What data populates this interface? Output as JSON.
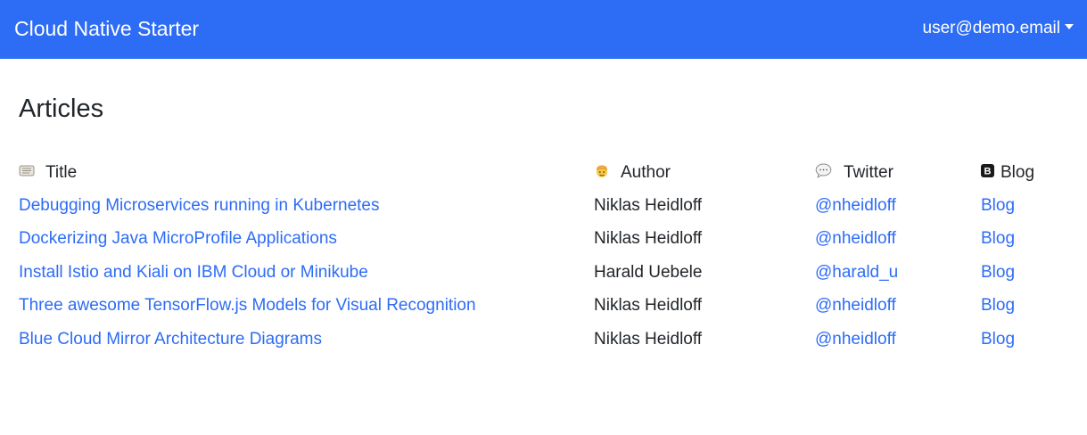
{
  "navbar": {
    "brand": "Cloud Native Starter",
    "user": "user@demo.email",
    "background": "#2d6cf5"
  },
  "page": {
    "title": "Articles"
  },
  "table": {
    "headers": {
      "title": "Title",
      "author": "Author",
      "twitter": "Twitter",
      "blog": "Blog"
    },
    "header_icons": {
      "title": "scroll-icon",
      "author": "person-icon",
      "twitter": "speech-balloon-icon",
      "blog": "bold-b-icon"
    },
    "rows": [
      {
        "title": "Debugging Microservices running in Kubernetes",
        "author": "Niklas Heidloff",
        "twitter": "@nheidloff",
        "blog": "Blog"
      },
      {
        "title": "Dockerizing Java MicroProfile Applications",
        "author": "Niklas Heidloff",
        "twitter": "@nheidloff",
        "blog": "Blog"
      },
      {
        "title": "Install Istio and Kiali on IBM Cloud or Minikube",
        "author": "Harald Uebele",
        "twitter": "@harald_u",
        "blog": "Blog"
      },
      {
        "title": "Three awesome TensorFlow.js Models for Visual Recognition",
        "author": "Niklas Heidloff",
        "twitter": "@nheidloff",
        "blog": "Blog"
      },
      {
        "title": "Blue Cloud Mirror Architecture Diagrams",
        "author": "Niklas Heidloff",
        "twitter": "@nheidloff",
        "blog": "Blog"
      }
    ]
  },
  "colors": {
    "link": "#2d6cf5",
    "text": "#212529"
  }
}
